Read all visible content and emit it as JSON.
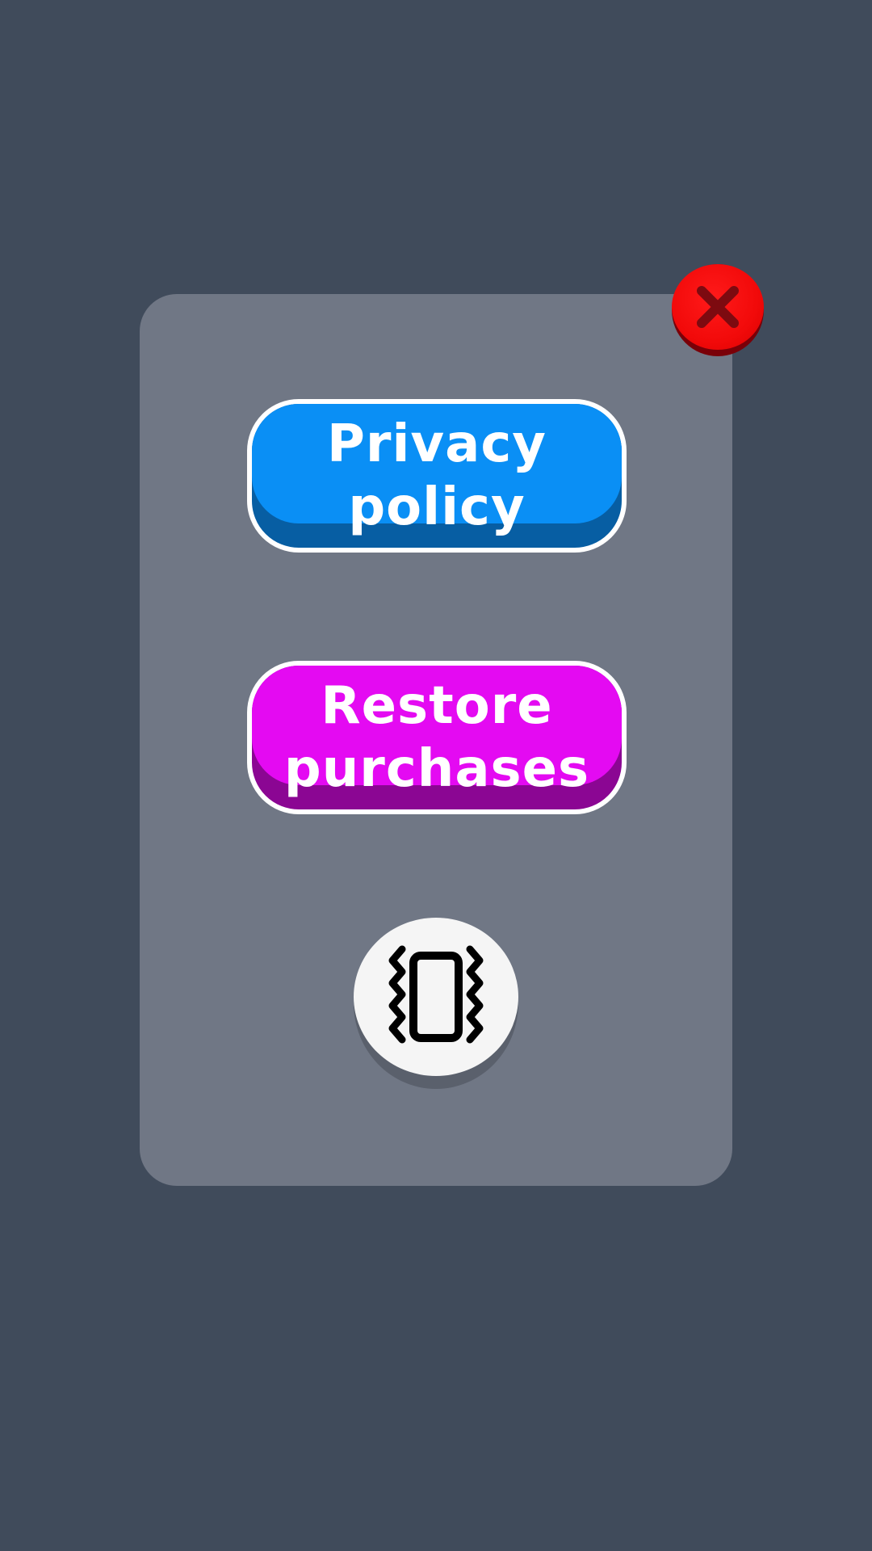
{
  "dialog": {
    "close_icon": "close-x-icon",
    "buttons": {
      "privacy_label": "Privacy\npolicy",
      "restore_label": "Restore\npurchases"
    },
    "vibration_icon": "vibration-phone-icon"
  },
  "colors": {
    "background": "#404b5b",
    "panel": "#707785",
    "close_red": "#f20a0a",
    "privacy_blue": "#0a8ff5",
    "restore_magenta": "#e40af2",
    "vibrate_white": "#f5f5f5"
  }
}
